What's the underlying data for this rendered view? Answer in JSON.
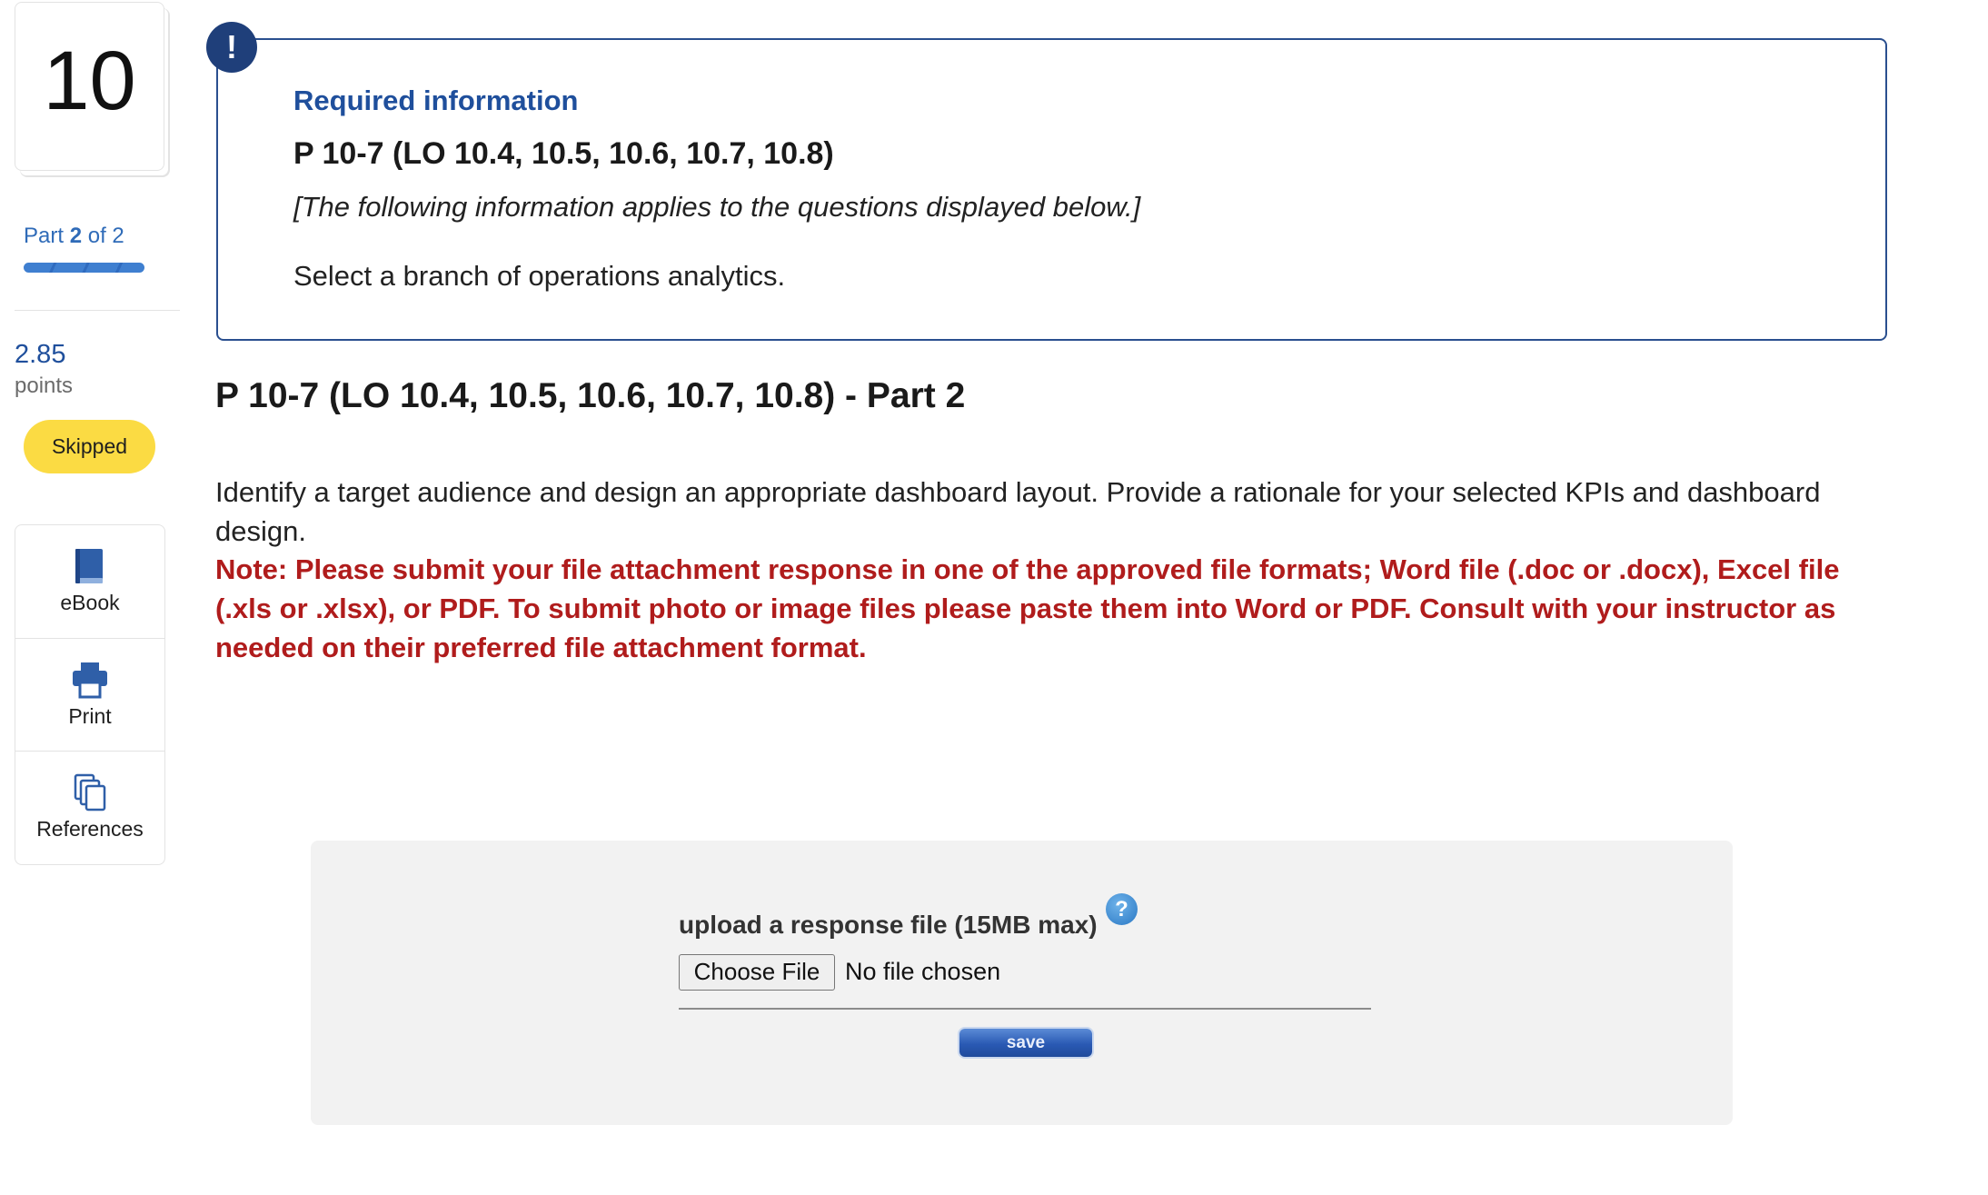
{
  "sidebar": {
    "question_number": "10",
    "part_word": "Part",
    "part_current": "2",
    "part_of": "of 2",
    "part_progress": 1.0,
    "points_value": "2.85",
    "points_label": "points",
    "status_badge": "Skipped",
    "tools": [
      {
        "label": "eBook",
        "icon": "book-icon"
      },
      {
        "label": "Print",
        "icon": "printer-icon"
      },
      {
        "label": "References",
        "icon": "copy-icon"
      }
    ]
  },
  "info": {
    "badge": "!",
    "title": "Required information",
    "problem_id": "P 10-7 (LO 10.4, 10.5, 10.6, 10.7, 10.8)",
    "applies_text": "[The following information applies to the questions displayed below.]",
    "instruction": "Select a branch of operations analytics."
  },
  "question": {
    "title": "P 10-7 (LO 10.4, 10.5, 10.6, 10.7, 10.8) - Part 2",
    "body": "Identify a target audience and design an appropriate dashboard layout. Provide a rationale for your selected KPIs and dashboard design.",
    "note": "Note: Please submit your file attachment response in one of the approved file formats; Word file (.doc or .docx), Excel file (.xls or .xlsx), or PDF. To submit photo or image files please paste them into Word or PDF. Consult with your instructor as needed on their preferred file attachment format."
  },
  "upload": {
    "label": "upload a response file (15MB max)",
    "help": "?",
    "choose_button": "Choose File",
    "file_status": "No file chosen",
    "save_button": "save"
  },
  "colors": {
    "accent_blue": "#1f4f9c",
    "info_border": "#2a4f8f",
    "badge_yellow": "#fbdb43",
    "note_red": "#b01c1c"
  }
}
